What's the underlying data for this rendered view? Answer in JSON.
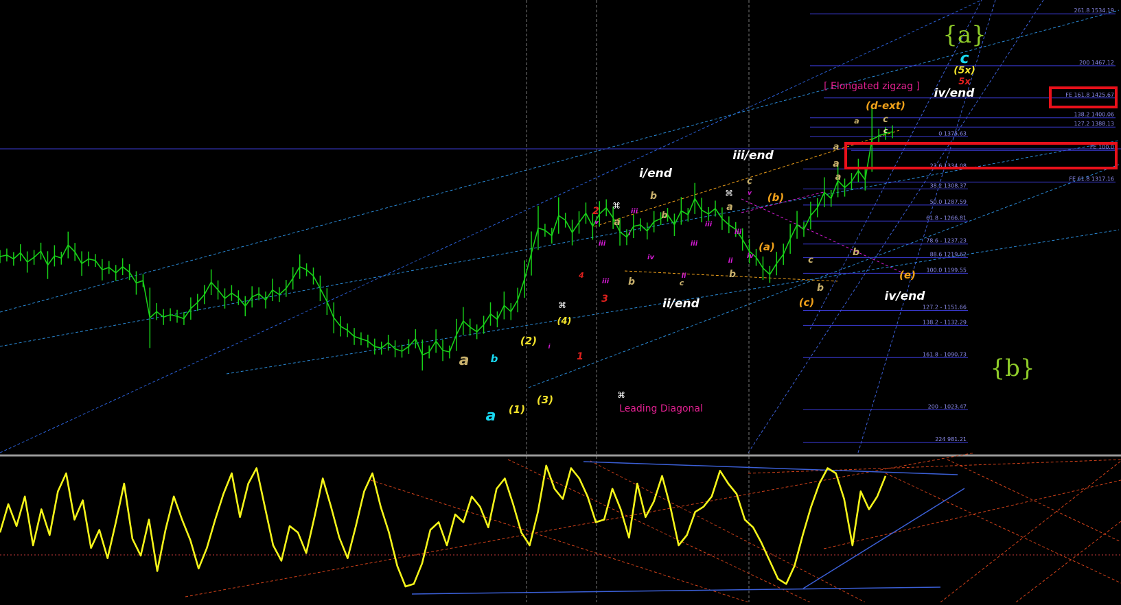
{
  "chart_data": {
    "type": "line",
    "title": "",
    "xlabel": "",
    "ylabel": "",
    "ylim": [
      968,
      1552
    ],
    "price_series": {
      "name": "",
      "values": [
        1221,
        1223,
        1218,
        1226,
        1214,
        1220,
        1228,
        1210,
        1222,
        1219,
        1236,
        1227,
        1212,
        1218,
        1216,
        1204,
        1207,
        1200,
        1208,
        1201,
        1187,
        1190,
        1142,
        1150,
        1143,
        1146,
        1144,
        1141,
        1154,
        1162,
        1172,
        1188,
        1178,
        1167,
        1174,
        1168,
        1157,
        1169,
        1173,
        1165,
        1178,
        1172,
        1180,
        1193,
        1208,
        1204,
        1196,
        1180,
        1163,
        1142,
        1131,
        1126,
        1118,
        1115,
        1112,
        1105,
        1103,
        1110,
        1102,
        1099,
        1105,
        1115,
        1094,
        1098,
        1112,
        1100,
        1098,
        1120,
        1138,
        1130,
        1124,
        1133,
        1147,
        1140,
        1158,
        1150,
        1165,
        1192,
        1225,
        1258,
        1255,
        1248,
        1274,
        1268,
        1252,
        1265,
        1277,
        1260,
        1276,
        1284,
        1271,
        1253,
        1246,
        1260,
        1262,
        1254,
        1266,
        1270,
        1275,
        1262,
        1280,
        1275,
        1296,
        1281,
        1276,
        1283,
        1270,
        1262,
        1256,
        1243,
        1228,
        1220,
        1206,
        1198,
        1212,
        1224,
        1244,
        1262,
        1256,
        1274,
        1284,
        1304,
        1296,
        1319,
        1310,
        1318,
        1332,
        1320,
        1372,
        1377,
        1380,
        1382
      ]
    },
    "fib_levels": [
      {
        "label": "261.8 1534.19",
        "value": 1534.19
      },
      {
        "label": "200 1467.12",
        "value": 1467.12
      },
      {
        "label": "FE 161.8 1425.67",
        "value": 1425.67
      },
      {
        "label": "138.2 1400.06",
        "value": 1400.06
      },
      {
        "label": "127.2 1388.13",
        "value": 1388.13
      },
      {
        "label": "0 1375.63",
        "value": 1375.63
      },
      {
        "label": "FE 100.0",
        "value": 1358.0
      },
      {
        "label": "23.6 1334.08",
        "value": 1334.08
      },
      {
        "label": "FE 61.8 1317.16",
        "value": 1317.16
      },
      {
        "label": "38.2 1308.37",
        "value": 1308.37
      },
      {
        "label": "50.0 1287.59",
        "value": 1287.59
      },
      {
        "label": "61.8 - 1266.81",
        "value": 1266.81
      },
      {
        "label": "78.6 - 1237.23",
        "value": 1237.23
      },
      {
        "label": "88.6 1219.62",
        "value": 1219.62
      },
      {
        "label": "100.0 1199.55",
        "value": 1199.55
      },
      {
        "label": "127.2 - 1151.66",
        "value": 1151.66
      },
      {
        "label": "138.2 - 1132.29",
        "value": 1132.29
      },
      {
        "label": "161.8 - 1090.73",
        "value": 1090.73
      },
      {
        "label": "200 - 1023.47",
        "value": 1023.47
      },
      {
        "label": "224 981.21",
        "value": 981.21
      }
    ],
    "oscillator": {
      "name": "",
      "values": [
        50,
        72,
        55,
        78,
        40,
        68,
        48,
        82,
        96,
        60,
        75,
        38,
        52,
        30,
        58,
        88,
        45,
        32,
        60,
        20,
        52,
        78,
        60,
        44,
        22,
        38,
        60,
        80,
        96,
        62,
        88,
        100,
        70,
        40,
        28,
        55,
        50,
        34,
        62,
        92,
        70,
        46,
        30,
        55,
        82,
        96,
        70,
        50,
        24,
        8,
        10,
        26,
        52,
        58,
        40,
        64,
        58,
        78,
        70,
        54,
        84,
        92,
        72,
        50,
        40,
        66,
        102,
        84,
        76,
        100,
        92,
        78,
        58,
        60,
        84,
        68,
        46,
        88,
        62,
        74,
        94,
        70,
        40,
        48,
        66,
        70,
        78,
        98,
        88,
        80,
        60,
        54,
        42,
        28,
        14,
        10,
        24,
        48,
        70,
        88,
        100,
        96,
        76,
        40,
        82,
        68,
        78,
        94
      ]
    },
    "wave_labels": [
      {
        "text": "{a}",
        "color": "#8fcc2a",
        "big": true
      },
      {
        "text": "{b}",
        "color": "#8fcc2a",
        "big": true
      },
      {
        "text": "c",
        "color": "#19d9f2"
      },
      {
        "text": "(5x)",
        "color": "#f2e22a"
      },
      {
        "text": "5x",
        "color": "#e0201d"
      },
      {
        "text": "iv/end",
        "color": "#ffffff"
      },
      {
        "text": "[ Elongated zigzag ]",
        "color": "#e0208f",
        "plain": true
      },
      {
        "text": "(d-ext)",
        "color": "#f0a11a"
      },
      {
        "text": "c",
        "color": "#c8b06c"
      },
      {
        "text": "c",
        "color": "#e8e49a"
      },
      {
        "text": "iii/end",
        "color": "#ffffff"
      },
      {
        "text": "i/end",
        "color": "#ffffff"
      },
      {
        "text": "ii/end",
        "color": "#ffffff"
      },
      {
        "text": "iv/end",
        "color": "#ffffff"
      },
      {
        "text": "c",
        "color": "#c8b06c"
      },
      {
        "text": "(b)",
        "color": "#f0a11a"
      },
      {
        "text": "(a)",
        "color": "#f0a11a"
      },
      {
        "text": "(c)",
        "color": "#f0a11a"
      },
      {
        "text": "(e)",
        "color": "#f0a11a"
      },
      {
        "text": "a",
        "color": "#c8b06c"
      },
      {
        "text": "a",
        "color": "#c8b06c"
      },
      {
        "text": "b",
        "color": "#c8b06c"
      },
      {
        "text": "a",
        "color": "#c8b06c"
      },
      {
        "text": "b",
        "color": "#c8b06c"
      },
      {
        "text": "b",
        "color": "#c8b06c"
      },
      {
        "text": "b",
        "color": "#c8b06c"
      },
      {
        "text": "b",
        "color": "#c8b06c"
      },
      {
        "text": "b",
        "color": "#c8b06c"
      },
      {
        "text": "c",
        "color": "#c8b06c"
      },
      {
        "text": "a",
        "color": "#c8b06c"
      },
      {
        "text": "a",
        "color": "#c8b06c"
      },
      {
        "text": "c",
        "color": "#c8b06c"
      },
      {
        "text": "a",
        "color": "#c8b06c"
      },
      {
        "text": "a",
        "color": "#c8b06c"
      },
      {
        "text": "a",
        "color": "#19d9f2"
      },
      {
        "text": "b",
        "color": "#19d9f2"
      },
      {
        "text": "(1)",
        "color": "#f2e22a"
      },
      {
        "text": "(2)",
        "color": "#f2e22a"
      },
      {
        "text": "(3)",
        "color": "#f2e22a"
      },
      {
        "text": "(4)",
        "color": "#f2e22a"
      },
      {
        "text": "1",
        "color": "#e0201d"
      },
      {
        "text": "2",
        "color": "#e0201d"
      },
      {
        "text": "3",
        "color": "#e0201d"
      },
      {
        "text": "4",
        "color": "#e0201d"
      },
      {
        "text": "iii",
        "color": "#d21ad2"
      },
      {
        "text": "iii",
        "color": "#d21ad2"
      },
      {
        "text": "iii",
        "color": "#d21ad2"
      },
      {
        "text": "iii",
        "color": "#d21ad2"
      },
      {
        "text": "iii",
        "color": "#d21ad2"
      },
      {
        "text": "iii",
        "color": "#d21ad2"
      },
      {
        "text": "iv",
        "color": "#d21ad2"
      },
      {
        "text": "iv",
        "color": "#d21ad2"
      },
      {
        "text": "ii",
        "color": "#d21ad2"
      },
      {
        "text": "ii",
        "color": "#d21ad2"
      },
      {
        "text": "v",
        "color": "#d21ad2"
      },
      {
        "text": "v",
        "color": "#d21ad2"
      },
      {
        "text": "i",
        "color": "#d21ad2"
      },
      {
        "text": "i",
        "color": "#d21ad2"
      },
      {
        "text": "⌘",
        "color": "#ffffff",
        "plain": true
      },
      {
        "text": "⌘",
        "color": "#ffffff",
        "plain": true
      },
      {
        "text": "⌘",
        "color": "#ffffff",
        "plain": true
      },
      {
        "text": "⌘",
        "color": "#ffffff",
        "plain": true
      },
      {
        "text": "Leading Diagonal",
        "color": "#e0208f",
        "plain": true
      }
    ],
    "colors": {
      "price": "#18d018",
      "oscillator": "#f5f51a",
      "fib_line": "#3b3bd6",
      "fib_text": "#8a8ae8",
      "channel": "#2a8ad6",
      "highlight": "#e8101a",
      "separator": "#9a9a9a"
    }
  }
}
